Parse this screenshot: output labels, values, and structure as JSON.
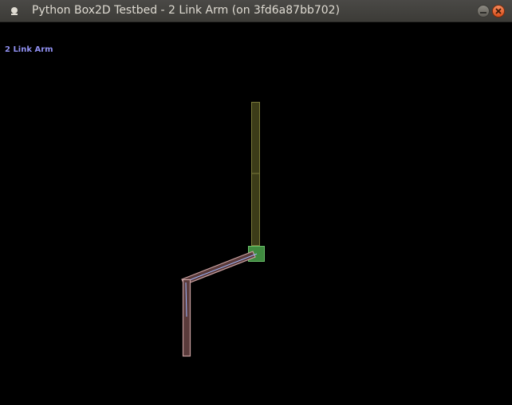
{
  "window": {
    "title": "Python Box2D Testbed - 2 Link Arm (on 3fd6a87bb702)"
  },
  "testbed": {
    "test_name": "2 Link Arm"
  },
  "colors": {
    "vertical_link_fill": "#3c3c18",
    "vertical_link_edge": "#7a7a3a",
    "hub_fill": "#3f8a3f",
    "hub_edge": "#6ac06a",
    "arm_link_fill": "#5a3b3b",
    "arm_link_edge": "#c9a0a0",
    "joint_line": "#9fb7ff"
  },
  "icons": {
    "window_menu": "window-menu-icon",
    "minimize": "minimize-icon",
    "close": "close-icon"
  }
}
